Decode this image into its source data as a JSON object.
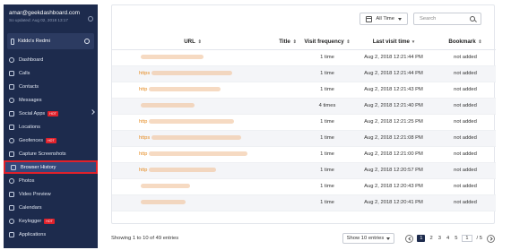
{
  "account": {
    "email": "amar@geekdashboard.com",
    "updated": "So updated: Aug 02, 2018 13:17",
    "device": "Kiddo's Redmi"
  },
  "sidebar": {
    "hot_label": "HOT",
    "items": [
      {
        "label": "Dashboard",
        "icon": "dashboard-icon",
        "hot": false
      },
      {
        "label": "Calls",
        "icon": "phone-icon",
        "hot": false
      },
      {
        "label": "Contacts",
        "icon": "contacts-icon",
        "hot": false
      },
      {
        "label": "Messages",
        "icon": "message-icon",
        "hot": false
      },
      {
        "label": "Social Apps",
        "icon": "chat-icon",
        "hot": true,
        "chevron": true
      },
      {
        "label": "Locations",
        "icon": "location-pin-icon",
        "hot": false
      },
      {
        "label": "Geofences",
        "icon": "geofence-icon",
        "hot": true
      },
      {
        "label": "Capture Screenshots",
        "icon": "screenshot-icon",
        "hot": false
      },
      {
        "label": "Browser History",
        "icon": "browser-icon",
        "hot": false,
        "active": true
      },
      {
        "label": "Photos",
        "icon": "photo-icon",
        "hot": false
      },
      {
        "label": "Video Preview",
        "icon": "video-icon",
        "hot": false
      },
      {
        "label": "Calendars",
        "icon": "calendar-icon",
        "hot": false
      },
      {
        "label": "Keylogger",
        "icon": "keyboard-icon",
        "hot": true
      },
      {
        "label": "Applications",
        "icon": "apps-icon",
        "hot": false
      }
    ]
  },
  "toolbar": {
    "time_filter": "All Time",
    "search_placeholder": "Search"
  },
  "table": {
    "headers": {
      "url": "URL",
      "title": "Title",
      "freq": "Visit frequency",
      "last": "Last visit time",
      "bookmark": "Bookmark"
    },
    "rows": [
      {
        "url_prefix": "",
        "freq": "1 time",
        "last": "Aug 2, 2018 12:21:44 PM",
        "bookmark": "not added"
      },
      {
        "url_prefix": "https",
        "freq": "1 time",
        "last": "Aug 2, 2018 12:21:44 PM",
        "bookmark": "not added"
      },
      {
        "url_prefix": "http",
        "freq": "1 time",
        "last": "Aug 2, 2018 12:21:43 PM",
        "bookmark": "not added"
      },
      {
        "url_prefix": "",
        "freq": "4 times",
        "last": "Aug 2, 2018 12:21:40 PM",
        "bookmark": "not added"
      },
      {
        "url_prefix": "http",
        "freq": "1 time",
        "last": "Aug 2, 2018 12:21:25 PM",
        "bookmark": "not added"
      },
      {
        "url_prefix": "https",
        "freq": "1 time",
        "last": "Aug 2, 2018 12:21:08 PM",
        "bookmark": "not added"
      },
      {
        "url_prefix": "http",
        "freq": "1 time",
        "last": "Aug 2, 2018 12:21:00 PM",
        "bookmark": "not added"
      },
      {
        "url_prefix": "http",
        "freq": "1 time",
        "last": "Aug 2, 2018 12:20:57 PM",
        "bookmark": "not added"
      },
      {
        "url_prefix": "",
        "freq": "1 time",
        "last": "Aug 2, 2018 12:20:43 PM",
        "bookmark": "not added"
      },
      {
        "url_prefix": "",
        "freq": "1 time",
        "last": "Aug 2, 2018 12:20:41 PM",
        "bookmark": "not added"
      }
    ]
  },
  "footer": {
    "info": "Showing 1 to 10 of 49 entries",
    "page_size": "Show 10 entries",
    "pages": [
      "1",
      "2",
      "3",
      "4",
      "5"
    ],
    "current_page": "1",
    "goto": "1",
    "total_pages": "/ 5"
  }
}
